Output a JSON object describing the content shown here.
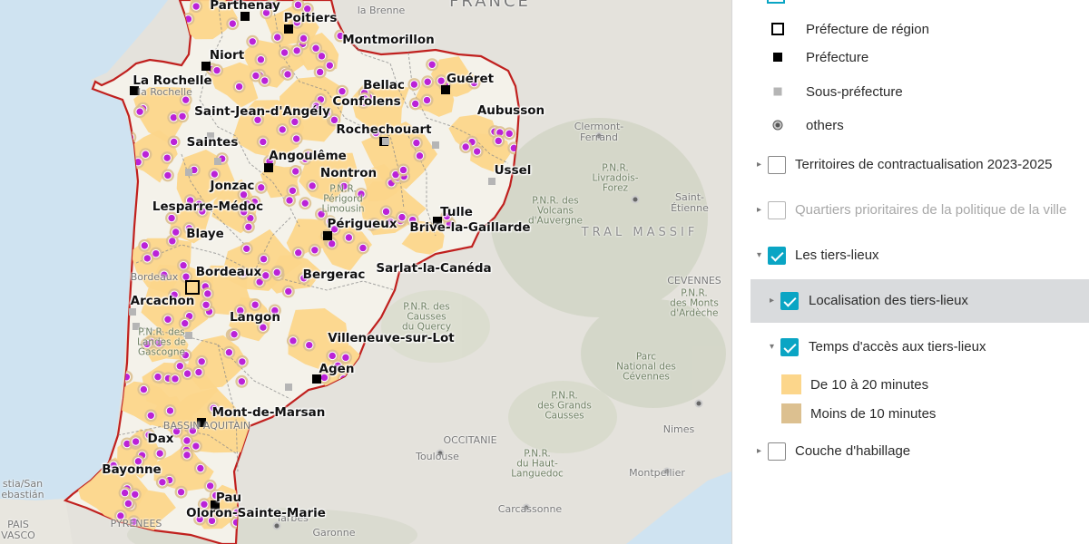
{
  "map": {
    "colors": {
      "background": "#e4e2dc",
      "sea": "#cfe3f1",
      "region_fill": "#f4f2ea",
      "region_border": "#c0201e",
      "access_10_20": "#fcd68b",
      "access_less_10": "#dcc090",
      "tiers_lieu_point": "#bb22d8"
    },
    "cities": [
      {
        "label": "Parthenay"
      },
      {
        "label": "Poitiers"
      },
      {
        "label": "Niort"
      },
      {
        "label": "Montmorillon"
      },
      {
        "label": "La Rochelle"
      },
      {
        "label": "Guéret"
      },
      {
        "label": "Bellac"
      },
      {
        "label": "Confolens"
      },
      {
        "label": "Saint-Jean-d'Angély"
      },
      {
        "label": "Aubusson"
      },
      {
        "label": "Rochechouart"
      },
      {
        "label": "Saintes"
      },
      {
        "label": "Angoulême"
      },
      {
        "label": "Ussel"
      },
      {
        "label": "Nontron"
      },
      {
        "label": "Jonzac"
      },
      {
        "label": "Lesparre-Médoc"
      },
      {
        "label": "Tulle"
      },
      {
        "label": "Périgueux"
      },
      {
        "label": "Brive-la-Gaillarde"
      },
      {
        "label": "Blaye"
      },
      {
        "label": "Sarlat-la-Canéda"
      },
      {
        "label": "Bordeaux"
      },
      {
        "label": "Bergerac"
      },
      {
        "label": "Arcachon"
      },
      {
        "label": "Langon"
      },
      {
        "label": "Villeneuve-sur-Lot"
      },
      {
        "label": "Agen"
      },
      {
        "label": "Mont-de-Marsan"
      },
      {
        "label": "Dax"
      },
      {
        "label": "Bayonne"
      },
      {
        "label": "Pau"
      },
      {
        "label": "Oloron-Sainte-Marie"
      }
    ],
    "basemap_labels": [
      {
        "text": "FRANCE"
      },
      {
        "text": "la Brenne"
      },
      {
        "text": "Clermont-\nFerrand"
      },
      {
        "text": "P.N.R.\nLivradois-\nForez"
      },
      {
        "text": "Saint-\nÉtienne"
      },
      {
        "text": "P.N.R. des\nVolcans\nd'Auvergne"
      },
      {
        "text": "TRAL MASSIF"
      },
      {
        "text": "CEVENNES"
      },
      {
        "text": "P.N.R.\ndes Monts\nd'Ardèche"
      },
      {
        "text": "P.N.R. des\nCausses\ndu Quercy"
      },
      {
        "text": "Parc\nNational des\nCévennes"
      },
      {
        "text": "P.N.R.\ndes Grands\nCausses"
      },
      {
        "text": "Nimes"
      },
      {
        "text": "OCCITANIE"
      },
      {
        "text": "Toulouse"
      },
      {
        "text": "P.N.R.\ndu Haut-\nLanguedoc"
      },
      {
        "text": "Montpellier"
      },
      {
        "text": "Carcassonne"
      },
      {
        "text": "Garonne"
      },
      {
        "text": "Tarbes"
      },
      {
        "text": "PYRENEES"
      },
      {
        "text": "PAIS\nVASCO"
      },
      {
        "text": "stia/San\nebastián"
      },
      {
        "text": "la Rochelle"
      },
      {
        "text": "Bordeaux"
      },
      {
        "text": "P.N.R. des\nLandes de\nGascogne"
      },
      {
        "text": "P.N.R.\nPérigord\nLimousin"
      },
      {
        "text": "BASSIN AQUITAIN"
      }
    ]
  },
  "legend": {
    "point_symbols": [
      {
        "label": "Préfecture de région",
        "symbol": "square-outline"
      },
      {
        "label": "Préfecture",
        "symbol": "square-filled"
      },
      {
        "label": "Sous-préfecture",
        "symbol": "square-grey"
      },
      {
        "label": "others",
        "symbol": "dot"
      }
    ],
    "layers": {
      "territoires": {
        "label": "Territoires de contractualisation 2023-2025",
        "checked": false
      },
      "quartiers": {
        "label": "Quartiers prioritaires de la politique de la ville",
        "checked": false,
        "disabled": true
      },
      "tiers_lieux": {
        "label": "Les tiers-lieux",
        "checked": true
      },
      "localisation": {
        "label": "Localisation des tiers-lieux",
        "checked": true,
        "selected": true
      },
      "temps": {
        "label": "Temps d'accès aux tiers-lieux",
        "checked": true
      },
      "habillage": {
        "label": "Couche d'habillage",
        "checked": false
      }
    },
    "access_classes": [
      {
        "label": "De 10 à 20 minutes",
        "color": "#fcd68b"
      },
      {
        "label": "Moins de 10 minutes",
        "color": "#dcc090"
      }
    ]
  }
}
